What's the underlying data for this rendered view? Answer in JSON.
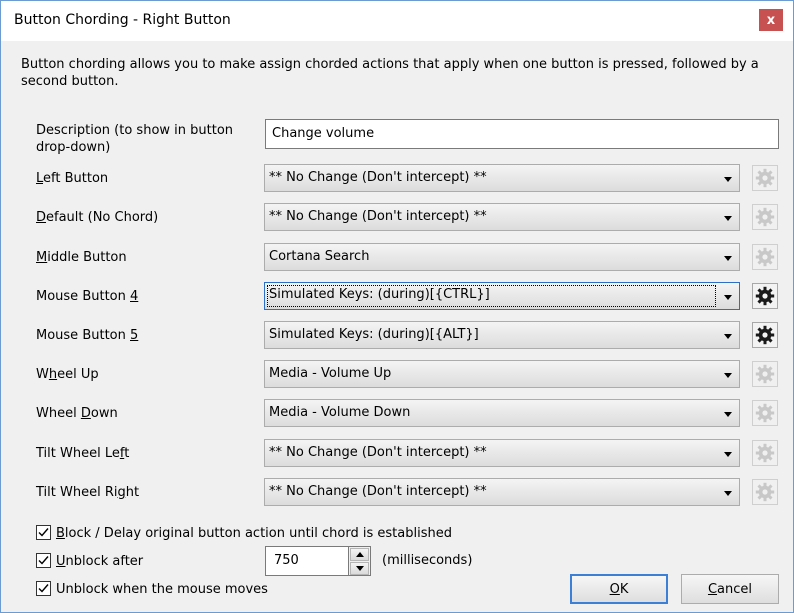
{
  "window": {
    "title": "Button Chording - Right Button",
    "close_label": "x"
  },
  "intro": "Button chording allows you to make assign chorded actions that apply when one button is pressed, followed by a second button.",
  "description": {
    "label": "Description (to show in button drop-down)",
    "value": "Change volume"
  },
  "rows": [
    {
      "label_pre": "",
      "label_key": "L",
      "label_post": "eft Button",
      "value": "** No Change (Don't intercept) **",
      "gear_enabled": false
    },
    {
      "label_pre": "",
      "label_key": "D",
      "label_post": "efault (No Chord)",
      "value": "** No Change (Don't intercept) **",
      "gear_enabled": false
    },
    {
      "label_pre": "",
      "label_key": "M",
      "label_post": "iddle Button",
      "value": "Cortana Search",
      "gear_enabled": false
    },
    {
      "label_pre": "Mouse Button ",
      "label_key": "4",
      "label_post": "",
      "value": "Simulated Keys: (during)[{CTRL}]",
      "gear_enabled": true
    },
    {
      "label_pre": "Mouse Button ",
      "label_key": "5",
      "label_post": "",
      "value": "Simulated Keys: (during)[{ALT}]",
      "gear_enabled": true
    },
    {
      "label_pre": "W",
      "label_key": "h",
      "label_post": "eel Up",
      "value": "Media - Volume Up",
      "gear_enabled": false
    },
    {
      "label_pre": "Wheel ",
      "label_key": "D",
      "label_post": "own",
      "value": "Media - Volume Down",
      "gear_enabled": false
    },
    {
      "label_pre": "Tilt Wheel Le",
      "label_key": "f",
      "label_post": "t",
      "value": "** No Change (Don't intercept) **",
      "gear_enabled": false
    },
    {
      "label_pre": "Tilt Wheel Ri",
      "label_key": "g",
      "label_post": "ht",
      "value": "** No Change (Don't intercept) **",
      "gear_enabled": false
    }
  ],
  "options": {
    "block_key": "B",
    "block_rest": "lock / Delay original button action until chord is established",
    "block_checked": true,
    "unblock_key": "U",
    "unblock_rest": "nblock after",
    "unblock_checked": true,
    "unblock_value": "750",
    "unblock_units": "(milliseconds)",
    "unblock_move_label": "Unblock when the mouse moves",
    "unblock_move_checked": true
  },
  "buttons": {
    "ok_key": "O",
    "ok_rest": "K",
    "cancel_key": "C",
    "cancel_rest": "ancel"
  },
  "icons": {
    "gear": "gear-icon",
    "check": "checkmark-icon",
    "close": "close-icon"
  }
}
